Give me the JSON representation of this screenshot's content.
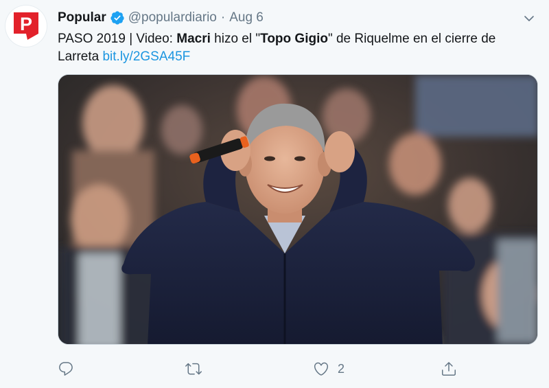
{
  "account": {
    "display_name": "Popular",
    "handle": "@populardiario",
    "separator": "·",
    "date": "Aug 6",
    "avatar_letter": "P"
  },
  "tweet": {
    "part1": "PASO 2019 | Video: ",
    "bold1": "Macri",
    "part2": " hizo el \"",
    "bold2": "Topo Gigio",
    "part3": "\" de Riquelme en el cierre de Larreta ",
    "link": "bit.ly/2GSA45F"
  },
  "actions": {
    "like_count": "2"
  },
  "icons": {
    "verified": "verified-badge-icon",
    "caret": "chevron-down-icon",
    "reply": "reply-icon",
    "retweet": "retweet-icon",
    "like": "heart-icon",
    "share": "share-icon"
  },
  "colors": {
    "brand_red": "#e2212a",
    "verified_blue": "#1da1f2",
    "link_blue": "#1b95e0",
    "muted_gray": "#657786"
  }
}
